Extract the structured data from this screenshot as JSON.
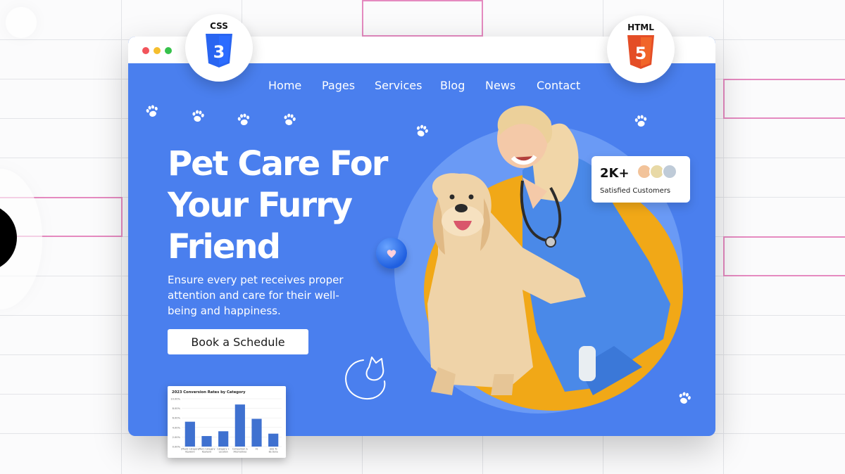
{
  "nav": {
    "items": [
      "Home",
      "Pages",
      "Services",
      "Blog",
      "News",
      "Contact"
    ]
  },
  "hero": {
    "title_lines": [
      "Pet Care For",
      "Your Furry",
      "Friend"
    ],
    "subtitle": "Ensure every pet receives proper attention and care for their well-being and happiness.",
    "cta_label": "Book a Schedule"
  },
  "customers_card": {
    "count": "2K+",
    "label": "Satisfied Customers"
  },
  "badges": {
    "css_label": "CSS",
    "html_label": "HTML",
    "css_digit": "3",
    "html_digit": "5"
  },
  "colors": {
    "hero_blue": "#4a7fee",
    "accent_orange": "#f1a817",
    "css_blue": "#2965f1",
    "html_orange": "#e44d26",
    "chart_bar": "#3f71d0"
  },
  "chart_data": {
    "type": "bar",
    "title": "2023 Conversion Rates by Category",
    "y_ticks": [
      "10.00%",
      "8.00%",
      "6.00%",
      "4.00%",
      "2.00%",
      "0.00%"
    ],
    "ylim": [
      0,
      10
    ],
    "categories": [
      "(Meet) Category Keyword",
      "(Man) Category Keyword",
      "Category + Location",
      "Comparison & Alternatives",
      "Vs",
      "Jobs To Be Done"
    ],
    "values": [
      5.2,
      2.2,
      3.2,
      8.8,
      5.8,
      2.7
    ]
  },
  "icons": [
    "paw-icon",
    "heart-icon",
    "cat-outline-icon",
    "css3-shield-icon",
    "html5-shield-icon"
  ]
}
